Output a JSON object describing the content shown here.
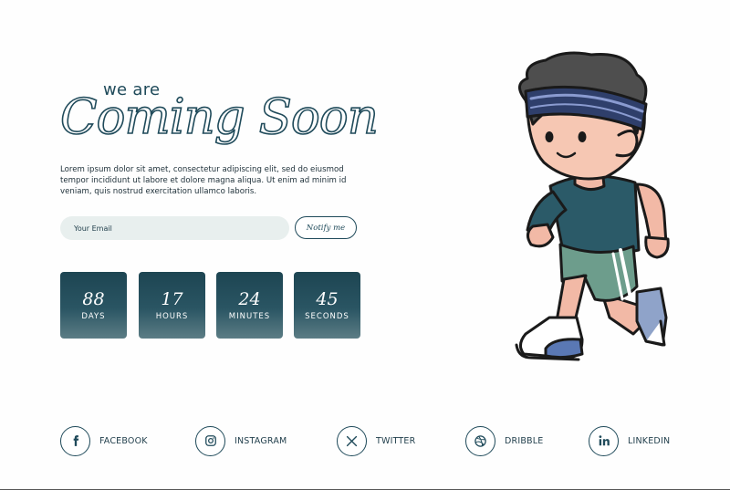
{
  "hero": {
    "pretitle": "we are",
    "title": "Coming Soon",
    "description": "Lorem ipsum dolor sit amet, consectetur adipiscing elit, sed do eiusmod tempor incididunt ut labore et dolore magna aliqua. Ut enim ad minim id veniam, quis nostrud exercitation ullamco laboris."
  },
  "subscribe": {
    "email_placeholder": "Your Email",
    "email_value": "",
    "button_label": "Notify me"
  },
  "countdown": [
    {
      "value": "88",
      "label": "DAYS"
    },
    {
      "value": "17",
      "label": "HOURS"
    },
    {
      "value": "24",
      "label": "MINUTES"
    },
    {
      "value": "45",
      "label": "SECONDS"
    }
  ],
  "illustration": {
    "icon": "running-boy-illustration"
  },
  "social": [
    {
      "label": "FACEBOOK",
      "icon": "facebook-icon"
    },
    {
      "label": "INSTAGRAM",
      "icon": "instagram-icon"
    },
    {
      "label": "TWITTER",
      "icon": "twitter-x-icon"
    },
    {
      "label": "DRIBBLE",
      "icon": "dribbble-icon"
    },
    {
      "label": "LINKEDIN",
      "icon": "linkedin-icon"
    }
  ],
  "colors": {
    "primary": "#1f4a5a",
    "card_gradient_top": "#1d4552",
    "card_gradient_bottom": "#5c7d85",
    "input_bg": "#e8efee",
    "background": "#fefefe"
  }
}
